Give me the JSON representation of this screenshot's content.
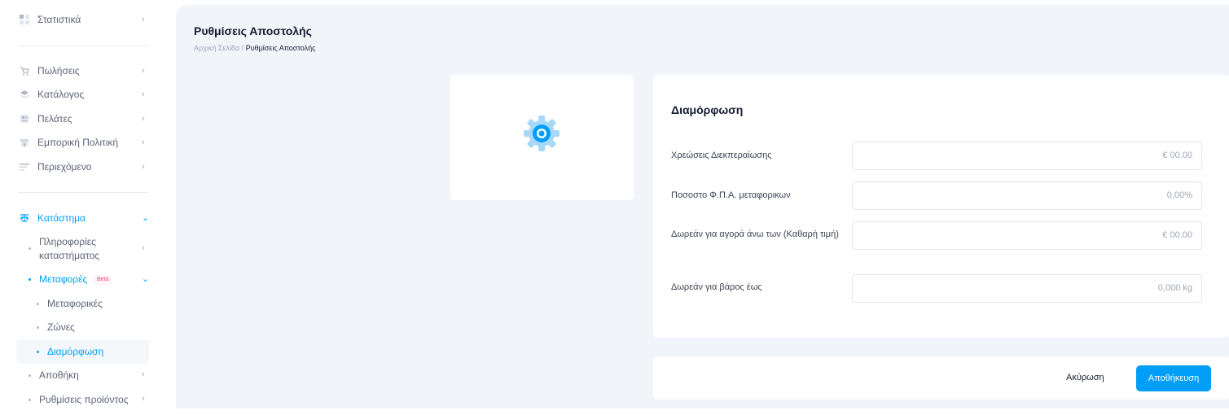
{
  "sidebar": {
    "stats": "Στατιστικά",
    "sales": "Πωλήσεις",
    "catalog": "Κατάλογος",
    "customers": "Πελάτες",
    "commercial_policy": "Εμπορική Πολιτική",
    "content": "Περιεχόμενο",
    "store": "Κατάστημα",
    "store_info_line1": "Πληροφορίες",
    "store_info_line2": "καταστήματος",
    "shipping": "Μεταφορές",
    "shipping_badge": "Beta",
    "carriers": "Μεταφορικές",
    "zones": "Ζώνες",
    "configuration": "Διαμόρφωση",
    "warehouse": "Αποθήκη",
    "product_settings": "Ρυθμίσεις προϊόντος"
  },
  "header": {
    "title": "Ρυθμίσεις Αποστολής",
    "breadcrumb_home": "Αρχική Σελίδα",
    "breadcrumb_sep": "/",
    "breadcrumb_current": "Ρυθμίσεις Αποστολής"
  },
  "form": {
    "title": "Διαμόρφωση",
    "fields": [
      {
        "label": "Χρεώσεις Διεκπεραίωσης",
        "value": "€ 00.00"
      },
      {
        "label": "Ποσοστο Φ.Π.Α. μεταφορικων",
        "value": "0,00%"
      },
      {
        "label": "Δωρεάν για αγορά άνω των (Καθαρή τιμή)",
        "value": "€ 00.00"
      },
      {
        "label": "Δωρεάν για βάρος έως",
        "value": "0,000 kg"
      }
    ]
  },
  "actions": {
    "cancel": "Ακύρωση",
    "save": "Αποθήκευση"
  },
  "colors": {
    "accent": "#009ef7",
    "background": "#f1f5f9",
    "badge": "#f1416c"
  }
}
